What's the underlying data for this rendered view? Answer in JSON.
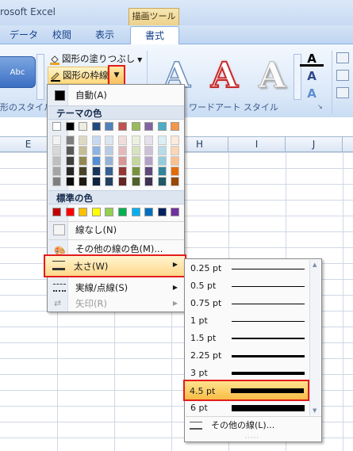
{
  "window": {
    "title_partial": "rosoft Excel",
    "context_tab": "描画ツール"
  },
  "tabs": [
    "データ",
    "校閲",
    "表示"
  ],
  "active_tab": "書式",
  "ribbon": {
    "shape_style_sample": "Abc",
    "shape_styles_group_label": "形のスタイル",
    "fill_label": "図形の塗りつぶし",
    "outline_label": "図形の枠線",
    "wordart_group_label": "ワードアート スタイル",
    "wordart_sample": "A",
    "text_fill_icon": "A",
    "text_outline_icon": "A",
    "text_effect_icon": "A"
  },
  "columns": [
    "E",
    "H",
    "I",
    "J"
  ],
  "menu": {
    "automatic": "自動(A)",
    "theme_colors_header": "テーマの色",
    "standard_colors_header": "標準の色",
    "no_line": "線なし(N)",
    "more_colors": "その他の線の色(M)...",
    "weight": "太さ(W)",
    "dashes": "実線/点線(S)",
    "arrows": "矢印(R)"
  },
  "theme_colors_top": [
    "#ffffff",
    "#000000",
    "#eeece1",
    "#1f497d",
    "#4f81bd",
    "#c0504d",
    "#9bbb59",
    "#8064a2",
    "#4bacc6",
    "#f79646"
  ],
  "theme_colors_shades": [
    [
      "#f2f2f2",
      "#7f7f7f",
      "#ddd9c3",
      "#c6d9f0",
      "#dbe5f1",
      "#f2dcdb",
      "#ebf1dd",
      "#e5e0ec",
      "#dbeef3",
      "#fdeada"
    ],
    [
      "#d8d8d8",
      "#595959",
      "#c4bd97",
      "#8db3e2",
      "#b8cce4",
      "#e5b9b7",
      "#d7e3bc",
      "#ccc1d9",
      "#b7dde8",
      "#fbd5b5"
    ],
    [
      "#bfbfbf",
      "#3f3f3f",
      "#938953",
      "#548dd4",
      "#95b3d7",
      "#d99694",
      "#c3d69b",
      "#b2a2c7",
      "#92cddc",
      "#fac08f"
    ],
    [
      "#a5a5a5",
      "#262626",
      "#494429",
      "#17365d",
      "#366092",
      "#953734",
      "#76923c",
      "#5f497a",
      "#31859b",
      "#e36c09"
    ],
    [
      "#7f7f7f",
      "#0c0c0c",
      "#1d1b10",
      "#0f243e",
      "#244061",
      "#632423",
      "#4f6128",
      "#3f3151",
      "#205867",
      "#974806"
    ]
  ],
  "standard_colors": [
    "#c00000",
    "#ff0000",
    "#ffc000",
    "#ffff00",
    "#92d050",
    "#00b050",
    "#00b0f0",
    "#0070c0",
    "#002060",
    "#7030a0"
  ],
  "weights": [
    {
      "label": "0.25 pt",
      "pt": 0.25
    },
    {
      "label": "0.5 pt",
      "pt": 0.5
    },
    {
      "label": "0.75 pt",
      "pt": 0.75
    },
    {
      "label": "1 pt",
      "pt": 1
    },
    {
      "label": "1.5 pt",
      "pt": 1.5
    },
    {
      "label": "2.25 pt",
      "pt": 2.25
    },
    {
      "label": "3 pt",
      "pt": 3
    },
    {
      "label": "4.5 pt",
      "pt": 4.5
    },
    {
      "label": "6 pt",
      "pt": 6
    }
  ],
  "selected_weight": "4.5 pt",
  "more_lines": "その他の線(L)...",
  "colors": {
    "highlight_border": "#e31c1c",
    "ribbon_accent": "#15428b"
  }
}
